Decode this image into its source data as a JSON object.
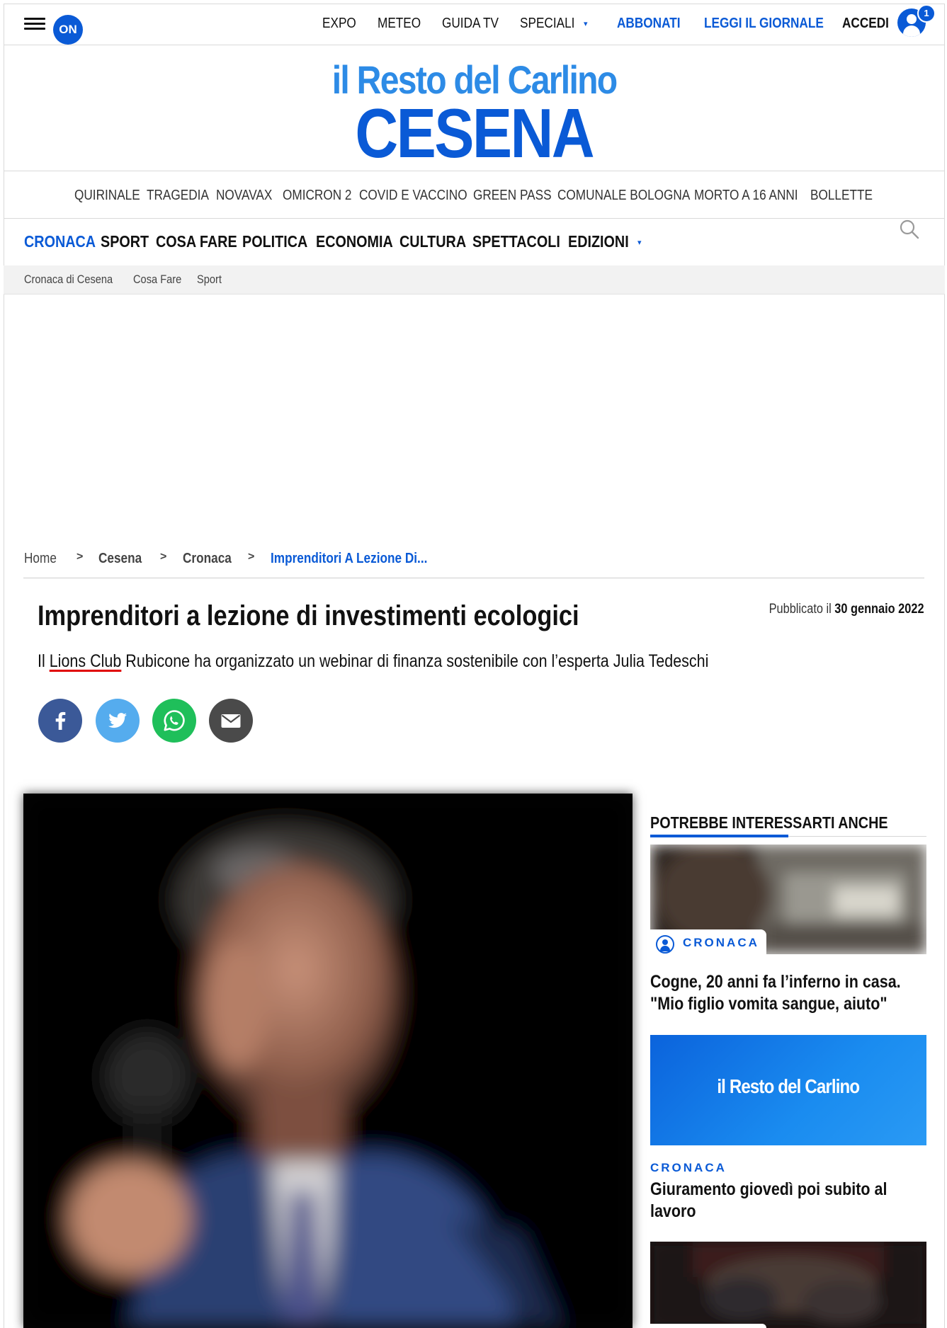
{
  "topbar": {
    "logo_badge": "ON",
    "nav": [
      "EXPO",
      "METEO",
      "GUIDA TV",
      "SPECIALI"
    ],
    "subscribe": "ABBONATI",
    "read_paper": "LEGGI IL GIORNALE",
    "login": "ACCEDI",
    "notifications": "1"
  },
  "masthead": {
    "brand": "il Resto del Carlino",
    "city": "CESENA"
  },
  "trending": [
    "QUIRINALE",
    "TRAGEDIA",
    "NOVAVAX",
    "OMICRON 2",
    "COVID E VACCINO",
    "GREEN PASS",
    "COMUNALE BOLOGNA",
    "MORTO A 16 ANNI",
    "BOLLETTE"
  ],
  "main_nav": [
    "CRONACA",
    "SPORT",
    "COSA FARE",
    "POLITICA",
    "ECONOMIA",
    "CULTURA",
    "SPETTACOLI",
    "EDIZIONI"
  ],
  "sub_nav": [
    "Cronaca di Cesena",
    "Cosa Fare",
    "Sport"
  ],
  "breadcrumb": [
    "Home",
    "Cesena",
    "Cronaca",
    "Imprenditori A Lezione Di..."
  ],
  "breadcrumb_sep": ">",
  "article": {
    "title": "Imprenditori a lezione di investimenti ecologici",
    "published_prefix": "Pubblicato il",
    "published_date": "30 gennaio 2022",
    "subtitle_pre": "Il ",
    "subtitle_link": "Lions Club",
    "subtitle_post": " Rubicone ha organizzato un webinar di finanza sostenibile con l’esperta Julia Tedeschi"
  },
  "share": [
    "facebook-icon",
    "twitter-icon",
    "whatsapp-icon",
    "email-icon"
  ],
  "colors": {
    "accent": "#0a5ad6",
    "brand_light": "#2d8be6",
    "facebook": "#3b5998",
    "twitter": "#55acee",
    "whatsapp": "#1fbf5a",
    "email": "#4a4a4a"
  },
  "sidebar": {
    "title": "POTREBBE INTERESSARTI ANCHE",
    "cards": [
      {
        "category": "CRONACA",
        "title_line1": "Cogne, 20 anni fa l’inferno in casa.",
        "title_line2": "\"Mio figlio vomita sangue, aiuto\""
      },
      {
        "logo": "il Resto del Carlino",
        "category": "CRONACA",
        "title_line1": "Giuramento giovedì poi subito al",
        "title_line2": "lavoro"
      }
    ]
  }
}
